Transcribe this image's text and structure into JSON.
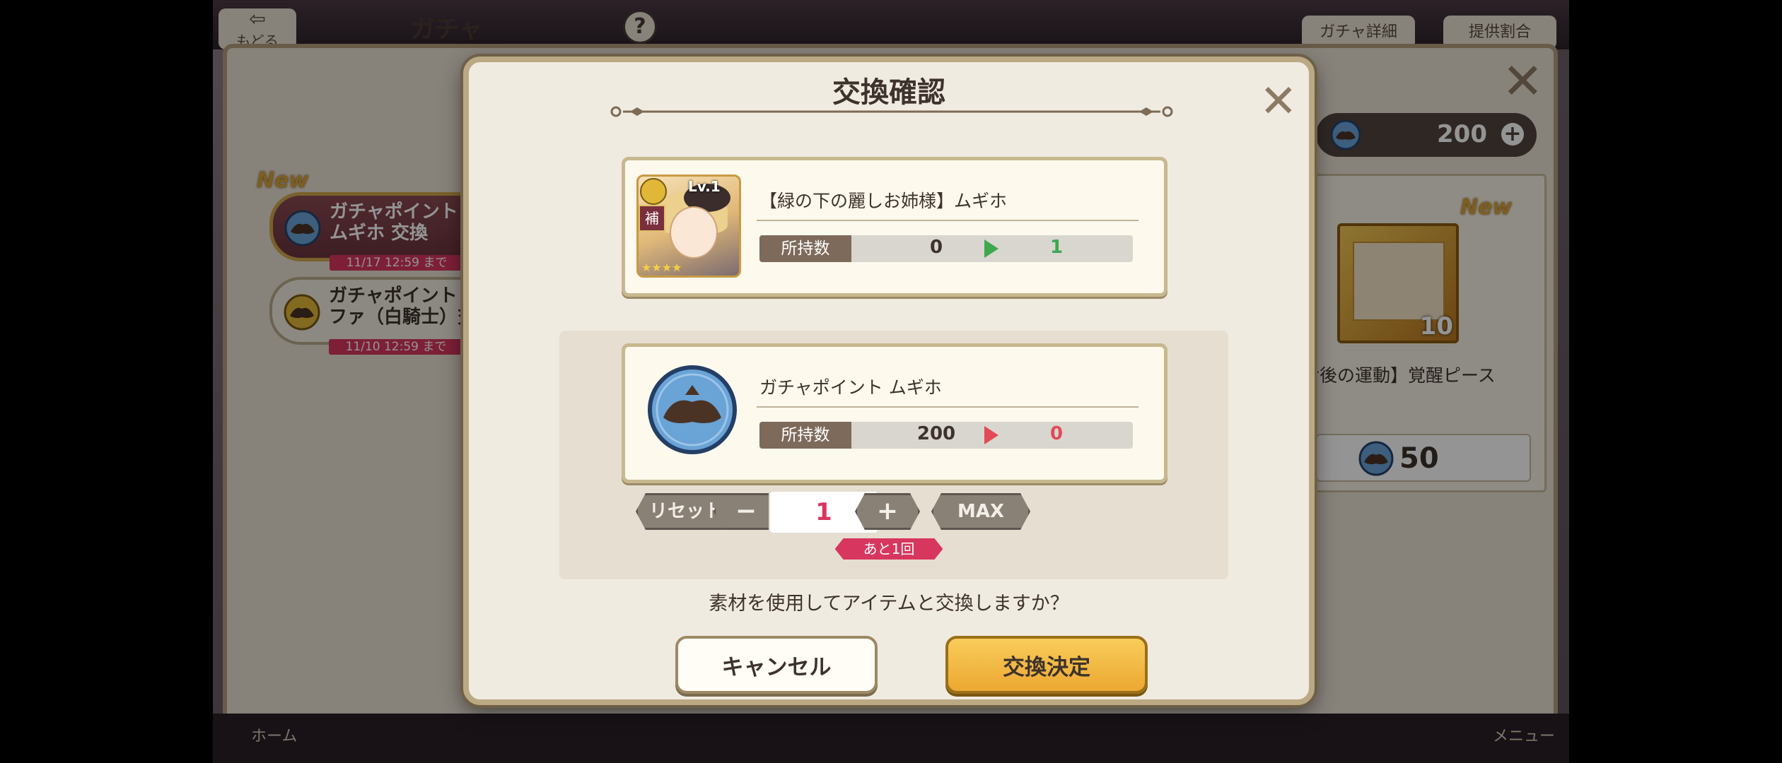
{
  "background": {
    "back_label": "もどる",
    "title": "ガチャ",
    "help_label": "?",
    "gacha_detail_label": "ガチャ詳細",
    "rate_label": "提供割合",
    "point_total": "200",
    "tabs": [
      {
        "title_line1": "ガチャポイント",
        "title_line2": "ムギホ 交換",
        "deadline": "11/17 12:59 まで",
        "new": "New"
      },
      {
        "title_line1": "ガチャポイント L",
        "title_line2": "ファ（白騎士）交",
        "deadline": "11/10 12:59 まで"
      }
    ],
    "item_card": {
      "new": "New",
      "count": "10",
      "name": "食後の運動】覚醒ピース",
      "cost": "50"
    },
    "nav_home": "ホーム",
    "nav_menu": "メニュー"
  },
  "modal": {
    "title": "交換確認",
    "reward": {
      "name": "【緑の下の麗しお姉様】ムギホ",
      "level_label": "Lv.1",
      "role_label": "補",
      "owned_label": "所持数",
      "owned_from": "0",
      "owned_to": "1"
    },
    "cost": {
      "name": "ガチャポイント ムギホ",
      "owned_label": "所持数",
      "owned_from": "200",
      "owned_to": "0"
    },
    "controls": {
      "reset_label": "リセット",
      "minus_label": "−",
      "quantity": "1",
      "plus_label": "+",
      "max_label": "MAX",
      "remaining": "あと1回"
    },
    "message": "素材を使用してアイテムと交換しますか？",
    "cancel_label": "キャンセル",
    "confirm_label": "交換決定"
  },
  "colors": {
    "accent_pink": "#d7365f",
    "increase_green": "#3ea84f",
    "decrease_red": "#e24a56",
    "confirm_gold": "#f3b843"
  }
}
